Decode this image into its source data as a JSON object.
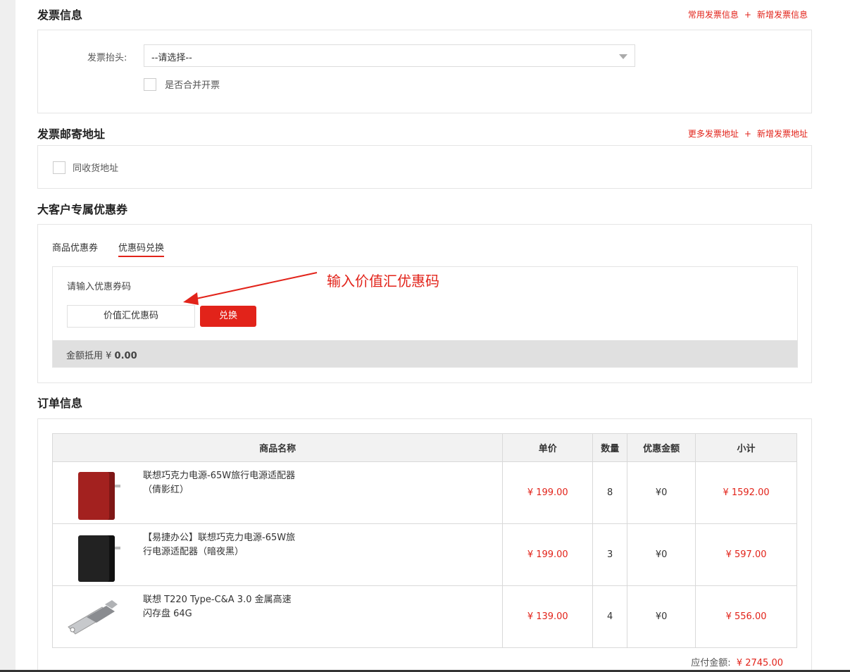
{
  "invoice": {
    "title": "发票信息",
    "link_common": "常用发票信息",
    "link_plus": "+",
    "link_add": "新增发票信息",
    "header_label": "发票抬头:",
    "header_select_value": "--请选择--",
    "merge_label": "是否合并开票"
  },
  "mailing": {
    "title": "发票邮寄地址",
    "link_more": "更多发票地址",
    "link_plus": "+",
    "link_add": "新增发票地址",
    "same_address_label": "同收货地址"
  },
  "coupon": {
    "title": "大客户专属优惠券",
    "tabs": [
      "商品优惠券",
      "优惠码兑换"
    ],
    "prompt": "请输入优惠券码",
    "input_value": "价值汇优惠码",
    "redeem_button": "兑换",
    "annotation": "输入价值汇优惠码",
    "deduction_label": "金额抵用 ¥",
    "deduction_value": "0.00"
  },
  "order": {
    "title": "订单信息",
    "columns": [
      "商品名称",
      "单价",
      "数量",
      "优惠金额",
      "小计"
    ],
    "rows": [
      {
        "name_line1": "联想巧克力电源-65W旅行电源适配器",
        "name_line2": "（倩影红）",
        "price": "¥ 199.00",
        "qty": "8",
        "discount": "¥0",
        "subtotal": "¥ 1592.00",
        "image": "red-power-adapter"
      },
      {
        "name_line1": "【易捷办公】联想巧克力电源-65W旅",
        "name_line2": "行电源适配器（暗夜黑）",
        "price": "¥ 199.00",
        "qty": "3",
        "discount": "¥0",
        "subtotal": "¥ 597.00",
        "image": "black-power-adapter"
      },
      {
        "name_line1": "联想 T220 Type-C&A 3.0 金属高速",
        "name_line2": "闪存盘 64G",
        "price": "¥ 139.00",
        "qty": "4",
        "discount": "¥0",
        "subtotal": "¥ 556.00",
        "image": "usb-flash-drive"
      }
    ],
    "total_label": "应付金额:",
    "total_value": "¥ 2745.00"
  },
  "colors": {
    "accent": "#e2231a",
    "header_bg": "#f2f2f2",
    "deduction_bg": "#e0e0e0"
  }
}
